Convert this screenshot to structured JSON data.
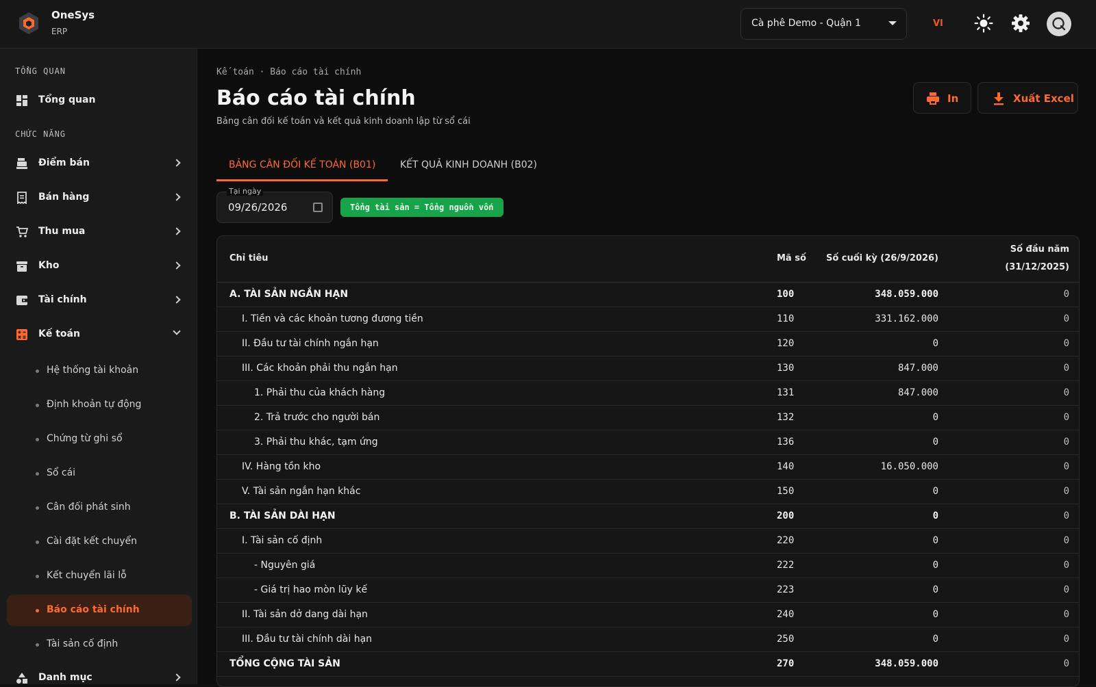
{
  "brand": {
    "name": "OneSys",
    "sub": "ERP"
  },
  "header": {
    "store": "Cà phê Demo - Quận 1",
    "lang": "VI"
  },
  "sidebar": {
    "section_overview": "TỔNG QUAN",
    "overview_item": "Tổng quan",
    "section_features": "CHỨC NĂNG",
    "items": [
      {
        "label": "Điểm bán",
        "icon": "cash-register-icon"
      },
      {
        "label": "Bán hàng",
        "icon": "receipt-icon"
      },
      {
        "label": "Thu mua",
        "icon": "cart-icon"
      },
      {
        "label": "Kho",
        "icon": "archive-icon"
      },
      {
        "label": "Tài chính",
        "icon": "wallet-icon"
      },
      {
        "label": "Kế toán",
        "icon": "calculator-icon"
      }
    ],
    "subitems": [
      "Hệ thống tài khoản",
      "Định khoản tự động",
      "Chứng từ ghi sổ",
      "Sổ cái",
      "Cân đối phát sinh",
      "Cài đặt kết chuyển",
      "Kết chuyển lãi lỗ",
      "Báo cáo tài chính",
      "Tài sản cố định"
    ],
    "next_item": "Danh mục"
  },
  "page": {
    "breadcrumb": "Kế toán · Báo cáo tài chính",
    "title": "Báo cáo tài chính",
    "subtitle": "Bảng cân đối kế toán và kết quả kinh doanh lập từ sổ cái",
    "print_label": "In",
    "export_label": "Xuất Excel",
    "tabs": [
      "BẢNG CÂN ĐỐI KẾ TOÁN (B01)",
      "KẾT QUẢ KINH DOANH (B02)"
    ],
    "date_caption": "Tại ngày",
    "date_value": "09/26/2026",
    "balance_badge": "Tổng tài sản = Tổng nguồn vốn"
  },
  "table": {
    "headers": [
      "Chỉ tiêu",
      "Mã số",
      "Số cuối kỳ (26/9/2026)",
      "Số đầu năm",
      "(31/12/2025)"
    ],
    "rows": [
      {
        "name": "A. TÀI SẢN NGẮN HẠN",
        "code": "100",
        "end": "348.059.000",
        "start": "0",
        "level": 0,
        "bold": true
      },
      {
        "name": "I. Tiền và các khoản tương đương tiền",
        "code": "110",
        "end": "331.162.000",
        "start": "0",
        "level": 1
      },
      {
        "name": "II. Đầu tư tài chính ngắn hạn",
        "code": "120",
        "end": "0",
        "start": "0",
        "level": 1
      },
      {
        "name": "III. Các khoản phải thu ngắn hạn",
        "code": "130",
        "end": "847.000",
        "start": "0",
        "level": 1
      },
      {
        "name": "1. Phải thu của khách hàng",
        "code": "131",
        "end": "847.000",
        "start": "0",
        "level": 2
      },
      {
        "name": "2. Trả trước cho người bán",
        "code": "132",
        "end": "0",
        "start": "0",
        "level": 2
      },
      {
        "name": "3. Phải thu khác, tạm ứng",
        "code": "136",
        "end": "0",
        "start": "0",
        "level": 2
      },
      {
        "name": "IV. Hàng tồn kho",
        "code": "140",
        "end": "16.050.000",
        "start": "0",
        "level": 1
      },
      {
        "name": "V. Tài sản ngắn hạn khác",
        "code": "150",
        "end": "0",
        "start": "0",
        "level": 1
      },
      {
        "name": "B. TÀI SẢN DÀI HẠN",
        "code": "200",
        "end": "0",
        "start": "0",
        "level": 0,
        "bold": true
      },
      {
        "name": "I. Tài sản cố định",
        "code": "220",
        "end": "0",
        "start": "0",
        "level": 1
      },
      {
        "name": "- Nguyên giá",
        "code": "222",
        "end": "0",
        "start": "0",
        "level": 2
      },
      {
        "name": "- Giá trị hao mòn lũy kế",
        "code": "223",
        "end": "0",
        "start": "0",
        "level": 2
      },
      {
        "name": "II. Tài sản dở dang dài hạn",
        "code": "240",
        "end": "0",
        "start": "0",
        "level": 1
      },
      {
        "name": "III. Đầu tư tài chính dài hạn",
        "code": "250",
        "end": "0",
        "start": "0",
        "level": 1
      },
      {
        "name": "TỔNG CỘNG TÀI SẢN",
        "code": "270",
        "end": "348.059.000",
        "start": "0",
        "level": 0,
        "bold": true
      }
    ]
  },
  "colors": {
    "accent": "#ff6a2c",
    "badge": "#16a34a",
    "background": "#0d0d0e",
    "sidebar": "#1a1a1b"
  }
}
